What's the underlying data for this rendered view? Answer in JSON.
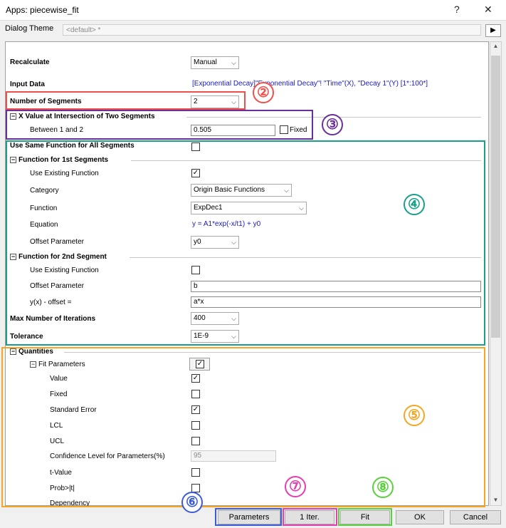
{
  "window": {
    "title": "Apps: piecewise_fit",
    "help": "?",
    "close": "✕"
  },
  "theme": {
    "label": "Dialog Theme",
    "value": "<default> *",
    "arrow": "▶"
  },
  "rows": {
    "recalculate": {
      "label": "Recalculate",
      "value": "Manual"
    },
    "input_data": {
      "label": "Input Data",
      "value": "[Exponential Decay]\"Exponential Decay\"! \"Time\"(X), \"Decay 1\"(Y) [1*:100*]"
    },
    "num_segments": {
      "label": "Number of Segments",
      "value": "2"
    },
    "x_intersection": {
      "label": "X Value at Intersection of Two Segments",
      "between_label": "Between 1 and 2",
      "between_value": "0.505",
      "fixed_label": "Fixed"
    },
    "use_same": {
      "label": "Use Same Function for All Segments"
    },
    "func1": {
      "label": "Function for 1st Segments",
      "use_existing_label": "Use Existing Function",
      "category_label": "Category",
      "category_value": "Origin Basic Functions",
      "function_label": "Function",
      "function_value": "ExpDec1",
      "equation_label": "Equation",
      "equation_value": "y = A1*exp(-x/t1) + y0",
      "offset_label": "Offset Parameter",
      "offset_value": "y0"
    },
    "func2": {
      "label": "Function for 2nd Segment",
      "use_existing_label": "Use Existing Function",
      "offset_label": "Offset Parameter",
      "offset_value": "b",
      "yx_label": "y(x) - offset =",
      "yx_value": "a*x"
    },
    "max_iter": {
      "label": "Max Number of Iterations",
      "value": "400"
    },
    "tolerance": {
      "label": "Tolerance",
      "value": "1E-9"
    },
    "quantities": {
      "label": "Quantities",
      "fit_params_label": "Fit Parameters",
      "value_label": "Value",
      "fixed_label": "Fixed",
      "stderr_label": "Standard Error",
      "lcl_label": "LCL",
      "ucl_label": "UCL",
      "conf_label": "Confidence Level for Parameters(%)",
      "conf_value": "95",
      "tvalue_label": "t-Value",
      "prob_label": "Prob>|t|",
      "dependency_label": "Dependency"
    }
  },
  "buttons": {
    "parameters": "Parameters",
    "iter": "1 Iter.",
    "fit": "Fit",
    "ok": "OK",
    "cancel": "Cancel"
  },
  "callouts": {
    "c2": "②",
    "c3": "③",
    "c4": "④",
    "c5": "⑤",
    "c6": "⑥",
    "c7": "⑦",
    "c8": "⑧"
  },
  "glyphs": {
    "dropdown": "⌵",
    "check": "✓",
    "minus": "−",
    "scroll_up": "▲",
    "scroll_down": "▼"
  },
  "colors": {
    "red": "#f0504a",
    "purple": "#6a2f9a",
    "teal": "#1aa08a",
    "orange": "#f5a623",
    "blue": "#3b5bdb",
    "magenta": "#e43fb0",
    "green": "#58d23c",
    "link": "#1a1ac8"
  }
}
